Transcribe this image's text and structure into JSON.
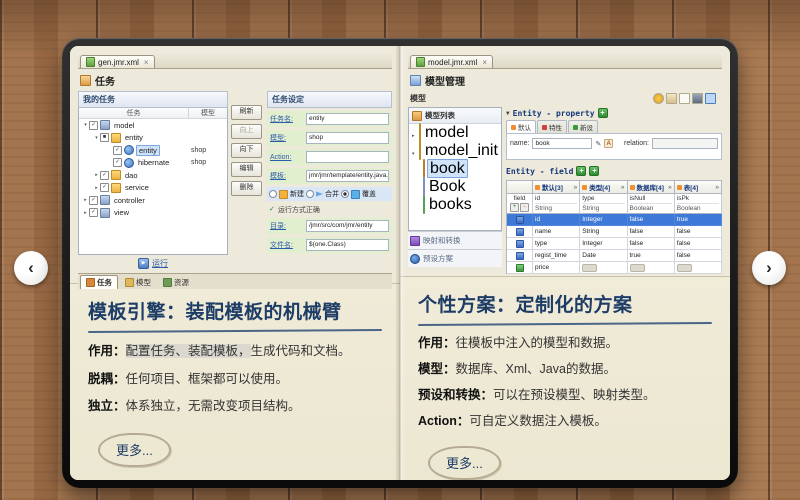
{
  "colors": {
    "wood": "#9a6b46",
    "frame": "#141414",
    "page": "#f2eedc",
    "heading": "#1d3c66",
    "selection": "#3e79d8",
    "field_row_bg": "#e2efcf",
    "link": "#2b5cab"
  },
  "icons": {
    "close": "×",
    "play": "▶",
    "collapse": "▼",
    "plus": "+",
    "minus": "-",
    "pencil": "✎",
    "font_a": "A",
    "chevrons": "»",
    "check": "✓"
  },
  "carousel": {
    "prev": "‹",
    "next": "›"
  },
  "left": {
    "tab": "gen.jmr.xml",
    "title": "任务",
    "tasks": {
      "header": "我的任务",
      "col_task": "任务",
      "col_model": "模型",
      "rows": [
        {
          "exp": "▾",
          "chk": "✓",
          "label": "model",
          "model": ""
        },
        {
          "exp": "▾",
          "chk": "■",
          "label": "entity",
          "model": ""
        },
        {
          "exp": "",
          "chk": "✓",
          "label": "entity",
          "model": "shop"
        },
        {
          "exp": "",
          "chk": "✓",
          "label": "hibernate",
          "model": "shop"
        },
        {
          "exp": "▸",
          "chk": "✓",
          "label": "dao",
          "model": ""
        },
        {
          "exp": "▸",
          "chk": "✓",
          "label": "service",
          "model": ""
        },
        {
          "exp": "▸",
          "chk": "✓",
          "label": "controller",
          "model": ""
        },
        {
          "exp": "▸",
          "chk": "✓",
          "label": "view",
          "model": ""
        }
      ],
      "run": "运行"
    },
    "buttons": [
      "刷新",
      "向上",
      "向下",
      "编辑",
      "删除"
    ],
    "settings": {
      "header": "任务设定",
      "fields": [
        {
          "label": "任务名:",
          "value": "entity"
        },
        {
          "label": "模型:",
          "value": "shop"
        },
        {
          "label": "Action:",
          "value": ""
        },
        {
          "label": "模板:",
          "value": "jmr/jmr/template/entity.java.jet"
        }
      ],
      "radios": [
        "新建",
        "合并",
        "覆盖"
      ],
      "status": "运行方式正确",
      "fields2": [
        {
          "label": "目录:",
          "value": "/jmr/src/com/jmr/entity"
        },
        {
          "label": "文件名:",
          "value": "$(one.Class)"
        }
      ]
    },
    "bottom_tabs": [
      "任务",
      "模型",
      "资源"
    ],
    "article": {
      "heading": "模板引擎：装配模板的机械臂",
      "l1_label": "作用：",
      "l1_hl": "配置任务、装配模板，",
      "l1_rest": "生成代码和文档。",
      "l2_label": "脱耦：",
      "l2_rest": "任何项目、框架都可以使用。",
      "l3_label": "独立：",
      "l3_rest": "体系独立，无需改变项目结构。",
      "more": "更多..."
    }
  },
  "right": {
    "tab": "model.jmr.xml",
    "title": "模型管理",
    "model_label": "模型",
    "list_header": "模型列表",
    "tree": [
      {
        "exp": "▸",
        "label": "model"
      },
      {
        "exp": "▾",
        "label": "model_init"
      },
      {
        "exp": "",
        "label": "book"
      },
      {
        "exp": "",
        "label": "Book"
      },
      {
        "exp": "",
        "label": "books"
      }
    ],
    "sections": [
      "映射和转换",
      "预设方案"
    ],
    "prop_header": "Entity - property",
    "prop_tabs": [
      "默认",
      "特性",
      "新设"
    ],
    "name_label": "name:",
    "name_value": "book",
    "relation_label": "relation:",
    "relation_value": "",
    "field_header": "Entity - field",
    "table": {
      "corner": "field",
      "groups": [
        "默认[3]",
        "类型[4]",
        "数据库[4]",
        "表[4]"
      ],
      "sub_names": [
        "id",
        "type",
        "isNull",
        "isPk"
      ],
      "sub_types": [
        "String",
        "String",
        "Boolean",
        "Boolean"
      ],
      "rows": [
        [
          "id",
          "Integer",
          "false",
          "true"
        ],
        [
          "name",
          "String",
          "false",
          "false"
        ],
        [
          "type",
          "Integer",
          "false",
          "false"
        ],
        [
          "regist_time",
          "Date",
          "true",
          "false"
        ],
        [
          "price",
          "",
          "",
          ""
        ]
      ]
    },
    "article": {
      "heading": "个性方案：定制化的方案",
      "l1_label": "作用：",
      "l1_rest": "往模板中注入的模型和数据。",
      "l2_label": "模型：",
      "l2_rest": "数据库、Xml、Java的数据。",
      "l3_label": "预设和转换：",
      "l3_rest": "可以在预设模型、映射类型。",
      "l4_label": "Action：",
      "l4_rest": "可自定义数据注入模板。",
      "more": "更多..."
    }
  }
}
